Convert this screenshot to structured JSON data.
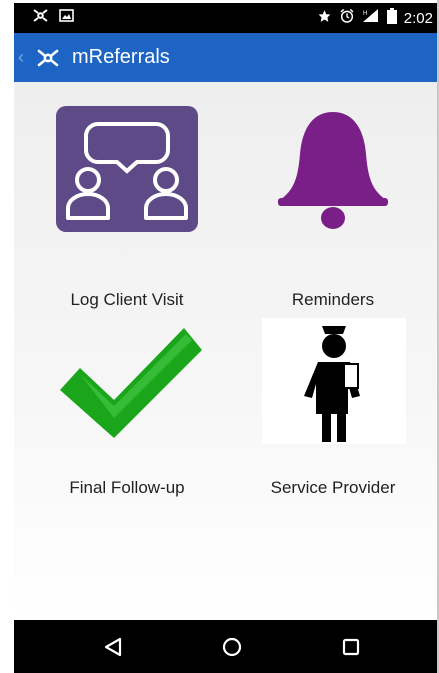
{
  "status_bar": {
    "time": "2:02",
    "left_icons": [
      "app-logo-icon",
      "image-icon"
    ],
    "right_icons": [
      "star-icon",
      "alarm-icon",
      "signal-icon",
      "battery-icon"
    ]
  },
  "app_bar": {
    "title": "mReferrals",
    "color": "#1e64c4"
  },
  "tiles": [
    {
      "label": "Log Client Visit",
      "icon": "client-visit-icon",
      "color": "#5e4a86"
    },
    {
      "label": "Reminders",
      "icon": "bell-icon",
      "color": "#7a1f87"
    },
    {
      "label": "Final Follow-up",
      "icon": "checkmark-icon",
      "color": "#1aa51a"
    },
    {
      "label": "Service Provider",
      "icon": "nurse-icon",
      "color": "#000000"
    }
  ],
  "nav_bar": {
    "buttons": [
      "back-icon",
      "home-icon",
      "recents-icon"
    ]
  }
}
